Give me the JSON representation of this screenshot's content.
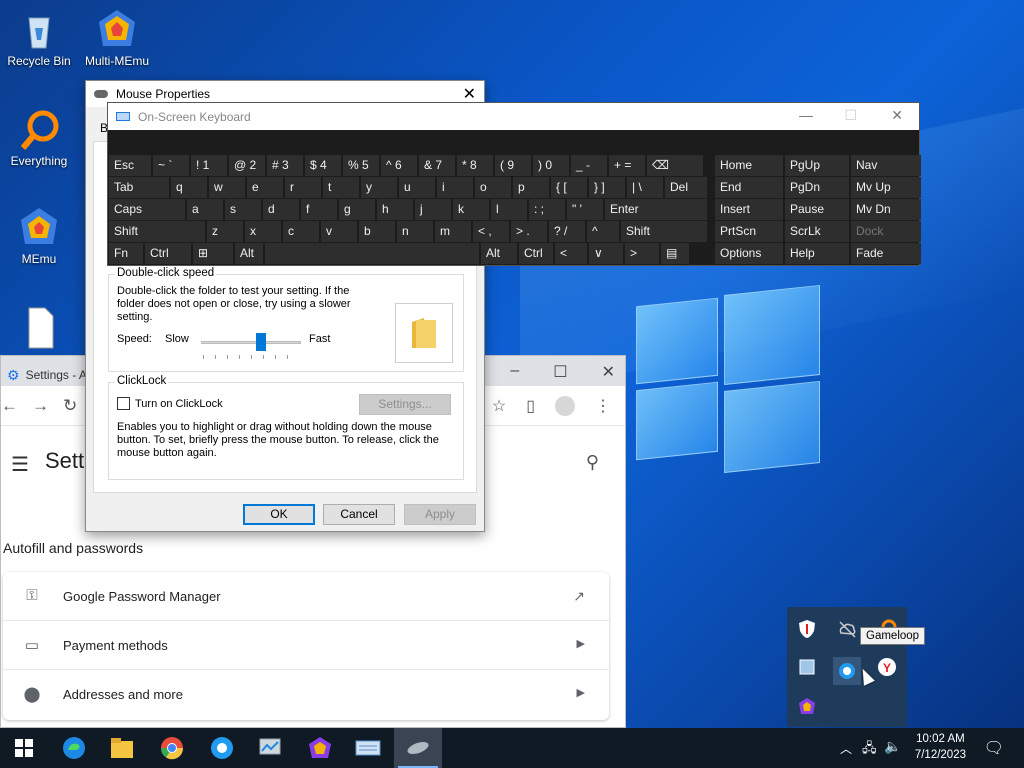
{
  "desktop": {
    "icons": [
      {
        "label": "Recycle Bin",
        "icon": "recycle-bin-icon"
      },
      {
        "label": "Multi-MEmu",
        "icon": "multi-memu-icon"
      },
      {
        "label": "Everything",
        "icon": "everything-search-icon"
      },
      {
        "label": "MEmu",
        "icon": "memu-icon"
      },
      {
        "label": "",
        "icon": "file-shortcut-icon"
      }
    ]
  },
  "chrome": {
    "tab_title": "Settings - A",
    "page_title": "Sett",
    "section_title": "Autofill and passwords",
    "rows": [
      {
        "label": "Google Password Manager",
        "icon": "key-icon",
        "trail": "external-link-icon"
      },
      {
        "label": "Payment methods",
        "icon": "credit-card-icon",
        "trail": "arrow-right-icon"
      },
      {
        "label": "Addresses and more",
        "icon": "location-pin-icon",
        "trail": "arrow-right-icon"
      }
    ]
  },
  "mouse_properties": {
    "title": "Mouse Properties",
    "tab_fragment": "B",
    "dblclick_group": "Double-click speed",
    "dblclick_text": "Double-click the folder to test your setting. If the folder does not open or close, try using a slower setting.",
    "speed_label": "Speed:",
    "slow_label": "Slow",
    "fast_label": "Fast",
    "speed_value": 0.6,
    "clicklock_group": "ClickLock",
    "clicklock_checkbox": "Turn on ClickLock",
    "clicklock_checked": false,
    "settings_button": "Settings...",
    "clicklock_text": "Enables you to highlight or drag without holding down the mouse button. To set, briefly press the mouse button. To release, click the mouse button again.",
    "ok": "OK",
    "cancel": "Cancel",
    "apply": "Apply"
  },
  "osk": {
    "title": "On-Screen Keyboard",
    "rows": [
      [
        "Esc",
        "~ `",
        "! 1",
        "@ 2",
        "# 3",
        "$ 4",
        "% 5",
        "^ 6",
        "& 7",
        "* 8",
        "( 9",
        ") 0",
        "_ -",
        "+ =",
        "⌫",
        "Home",
        "PgUp",
        "Nav"
      ],
      [
        "Tab",
        "q",
        "w",
        "e",
        "r",
        "t",
        "y",
        "u",
        "i",
        "o",
        "p",
        "{ [",
        "} ]",
        "| \\",
        "Del",
        "End",
        "PgDn",
        "Mv Up"
      ],
      [
        "Caps",
        "a",
        "s",
        "d",
        "f",
        "g",
        "h",
        "j",
        "k",
        "l",
        ": ;",
        "\" '",
        "Enter",
        "Insert",
        "Pause",
        "Mv Dn"
      ],
      [
        "Shift",
        "z",
        "x",
        "c",
        "v",
        "b",
        "n",
        "m",
        "< ,",
        "> .",
        "? /",
        "^",
        "Shift",
        "PrtScn",
        "ScrLk",
        "Dock"
      ],
      [
        "Fn",
        "Ctrl",
        "⊞",
        "Alt",
        "",
        "Alt",
        "Ctrl",
        "<",
        "∨",
        ">",
        "▤",
        "Options",
        "Help",
        "Fade"
      ]
    ]
  },
  "tray": {
    "tooltip": "Gameloop",
    "icons": [
      "security-shield-icon",
      "cloud-offline-icon",
      "orange-app-icon",
      "app-window-icon",
      "gameloop-icon",
      "yandex-icon",
      "colorful-hex-icon"
    ]
  },
  "taskbar": {
    "apps": [
      "windows-start-icon",
      "edge-icon",
      "file-explorer-icon",
      "chrome-icon",
      "gameloop-taskbar-icon",
      "control-panel-icon",
      "colorful-hex-taskbar-icon",
      "on-screen-keyboard-taskbar-icon",
      "mouse-taskbar-icon"
    ],
    "time": "10:02 AM",
    "date": "7/12/2023"
  }
}
